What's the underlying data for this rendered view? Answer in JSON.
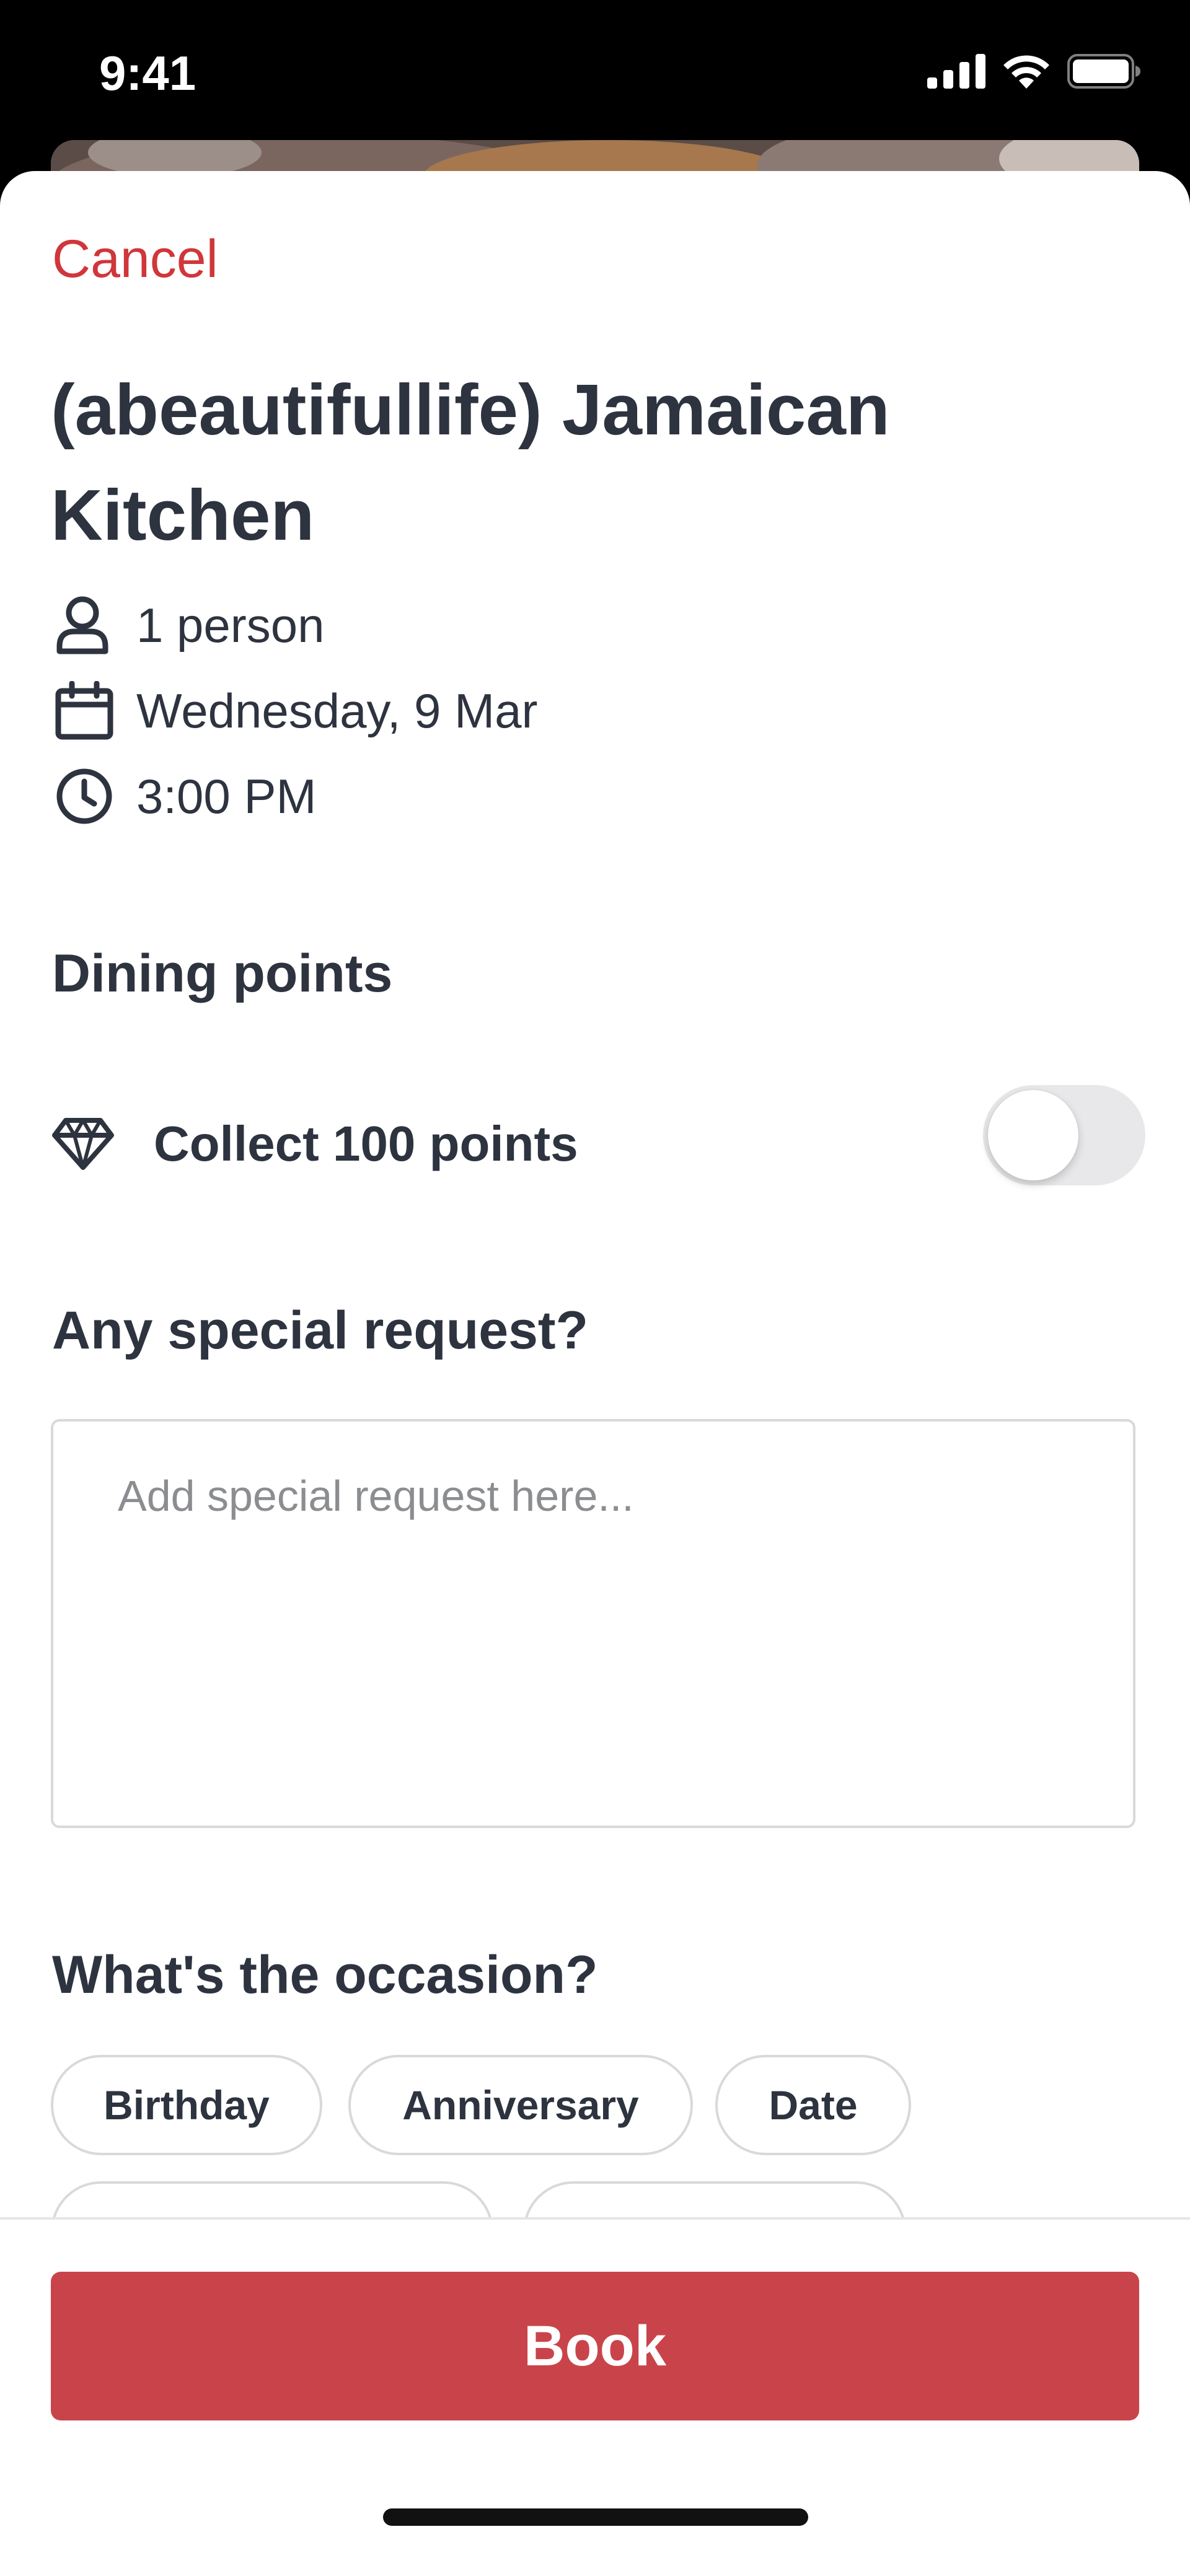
{
  "status_bar": {
    "time": "9:41"
  },
  "header": {
    "cancel_label": "Cancel"
  },
  "restaurant": {
    "name": "(abeautifullife) Jamaican Kitchen"
  },
  "details": {
    "party_size": "1 person",
    "date": "Wednesday, 9 Mar",
    "time": "3:00 PM"
  },
  "dining_points": {
    "heading": "Dining points",
    "label": "Collect 100 points",
    "toggle_on": false
  },
  "special_request": {
    "heading": "Any special request?",
    "placeholder": "Add special request here...",
    "value": ""
  },
  "occasion": {
    "heading": "What's the occasion?",
    "options": [
      "Birthday",
      "Anniversary",
      "Date"
    ]
  },
  "footer": {
    "book_label": "Book"
  },
  "colors": {
    "accent": "#d0363a",
    "button": "#c9444a",
    "text": "#2d333f"
  }
}
